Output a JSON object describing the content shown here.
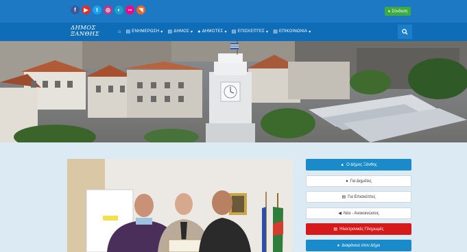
{
  "colors": {
    "topbar": "#1d79c4",
    "navbar": "#0f6db8",
    "primary_button": "#1a8ac9",
    "payments_button": "#d41a1a",
    "login_button": "#3eab3e",
    "background": "#dbeaf3"
  },
  "socials": [
    {
      "name": "facebook",
      "glyph": "f",
      "color": "#3b5998"
    },
    {
      "name": "youtube",
      "glyph": "▶",
      "color": "#e52d27"
    },
    {
      "name": "twitter",
      "glyph": "t",
      "color": "#1da1f2"
    },
    {
      "name": "instagram",
      "glyph": "◎",
      "color": "#c13584"
    },
    {
      "name": "website",
      "glyph": "◐",
      "color": "#1ba1c9"
    },
    {
      "name": "flickr",
      "glyph": "●●",
      "color": "#ff0084"
    },
    {
      "name": "rss",
      "glyph": "◥",
      "color": "#f26522"
    }
  ],
  "login": {
    "icon": "user-icon",
    "label": "Σύνδεση"
  },
  "logo": {
    "line1": "ΔΗΜΟΣ",
    "line2": "ΞΑΝΘΗΣ"
  },
  "nav": [
    {
      "icon": "newspaper-icon",
      "label": "ΕΝΗΜΕΡΩΣΗ"
    },
    {
      "icon": "building-icon",
      "label": "ΔΗΜΟΣ"
    },
    {
      "icon": "citizens-icon",
      "label": "ΔΗΜΟΤΕΣ"
    },
    {
      "icon": "visitors-icon",
      "label": "ΕΠΙΣΚΕΠΤΕΣ"
    },
    {
      "icon": "contact-icon",
      "label": "ΕΠΙΚΟΙΝΩΝΙΑ"
    }
  ],
  "sidebar": [
    {
      "label": "Ο Δήμος Ξάνθης",
      "icon": "institution-icon",
      "style": "blue"
    },
    {
      "label": "Για Δημότες",
      "icon": "users-icon",
      "style": "white"
    },
    {
      "label": "Για Επισκέπτες",
      "icon": "suitcase-icon",
      "style": "white"
    },
    {
      "label": "Νέα - Ανακοινώσεις",
      "icon": "megaphone-icon",
      "style": "white"
    },
    {
      "label": "Ηλεκτρονικές Πληρωμές",
      "icon": "credit-card-icon",
      "style": "red"
    },
    {
      "label": "Διαφάνεια στον Δήμο",
      "icon": "circle-icon",
      "style": "blue"
    }
  ]
}
